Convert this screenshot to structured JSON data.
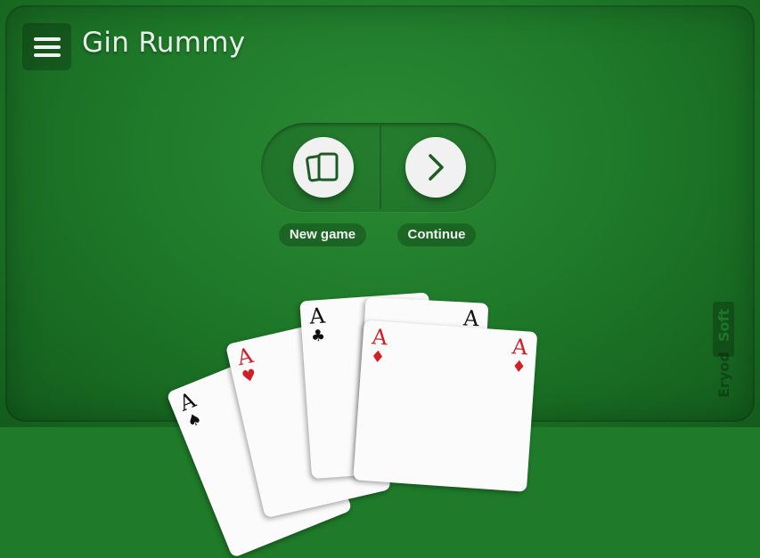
{
  "header": {
    "menu_icon": "hamburger-menu-icon",
    "title": "Gin Rummy"
  },
  "actions": {
    "new_game": {
      "label": "New game",
      "icon": "cards-stack-icon"
    },
    "continue": {
      "label": "Continue",
      "icon": "chevron-right-icon"
    }
  },
  "cards": [
    {
      "rank": "A",
      "suit": "♠",
      "color": "#111111"
    },
    {
      "rank": "A",
      "suit": "♥",
      "color": "#d01f26"
    },
    {
      "rank": "A",
      "suit": "♣",
      "color": "#111111"
    },
    {
      "rank": "A",
      "suit": "♦",
      "color": "#d01f26"
    },
    {
      "rank": "A",
      "suit": "♦",
      "color": "#d01f26"
    }
  ],
  "watermark": {
    "text": "Eryod Soft"
  },
  "colors": {
    "felt": "#1f7a2a",
    "felt_dark": "#135c1c",
    "card": "#fbfbfb",
    "button": "#f1f1f1",
    "icon": "#1d5c24"
  }
}
